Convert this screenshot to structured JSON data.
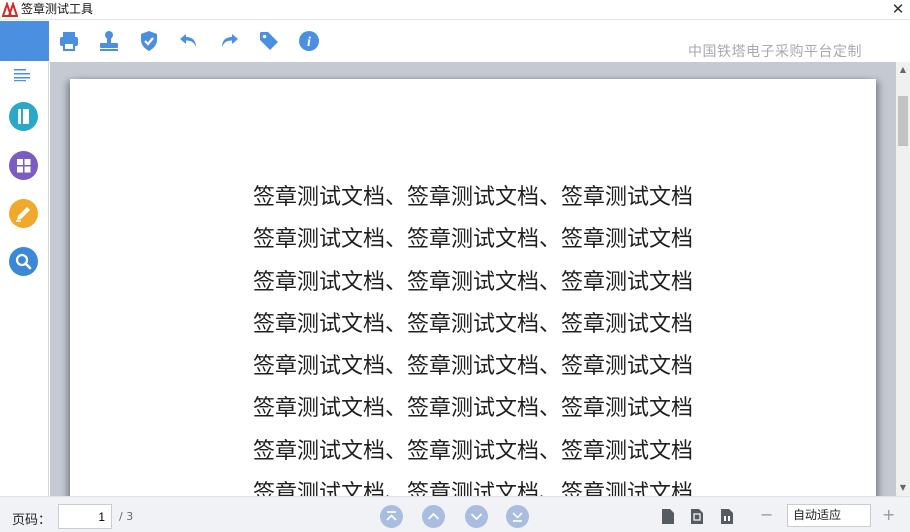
{
  "window": {
    "title": "签章测试工具",
    "close_glyph": "✕"
  },
  "toolbar": {
    "brand_text": "中国铁塔电子采购平台定制",
    "tools": [
      "printer-icon",
      "stamp-icon",
      "shield-check-icon",
      "undo-icon",
      "redo-icon",
      "tag-icon",
      "info-icon"
    ],
    "icon_color": "#4a8fe0"
  },
  "sidebar": {
    "menu_icon": "outline-list-icon",
    "buttons": [
      {
        "icon": "bookmark-icon",
        "color": "#2aa7c9"
      },
      {
        "icon": "thumbnails-icon",
        "color": "#7a5cc2"
      },
      {
        "icon": "pen-icon",
        "color": "#f0a92a"
      },
      {
        "icon": "search-icon",
        "color": "#3a88d6"
      }
    ]
  },
  "document": {
    "lines": [
      "签章测试文档、签章测试文档、签章测试文档",
      "签章测试文档、签章测试文档、签章测试文档",
      "签章测试文档、签章测试文档、签章测试文档",
      "签章测试文档、签章测试文档、签章测试文档",
      "签章测试文档、签章测试文档、签章测试文档",
      "签章测试文档、签章测试文档、签章测试文档",
      "签章测试文档、签章测试文档、签章测试文档",
      "签章测试文档、签章测试文档、签章测试文档"
    ]
  },
  "statusbar": {
    "page_label": "页码：",
    "current_page": "1",
    "total_pages": "/ 3",
    "nav_buttons": [
      "first-page-icon",
      "previous-page-icon",
      "next-page-icon",
      "last-page-icon"
    ],
    "view_icons": [
      "single-page-icon",
      "fit-page-icon",
      "continuous-page-icon"
    ],
    "zoom_minus": "−",
    "zoom_value": "自动适应",
    "zoom_plus": "+"
  }
}
